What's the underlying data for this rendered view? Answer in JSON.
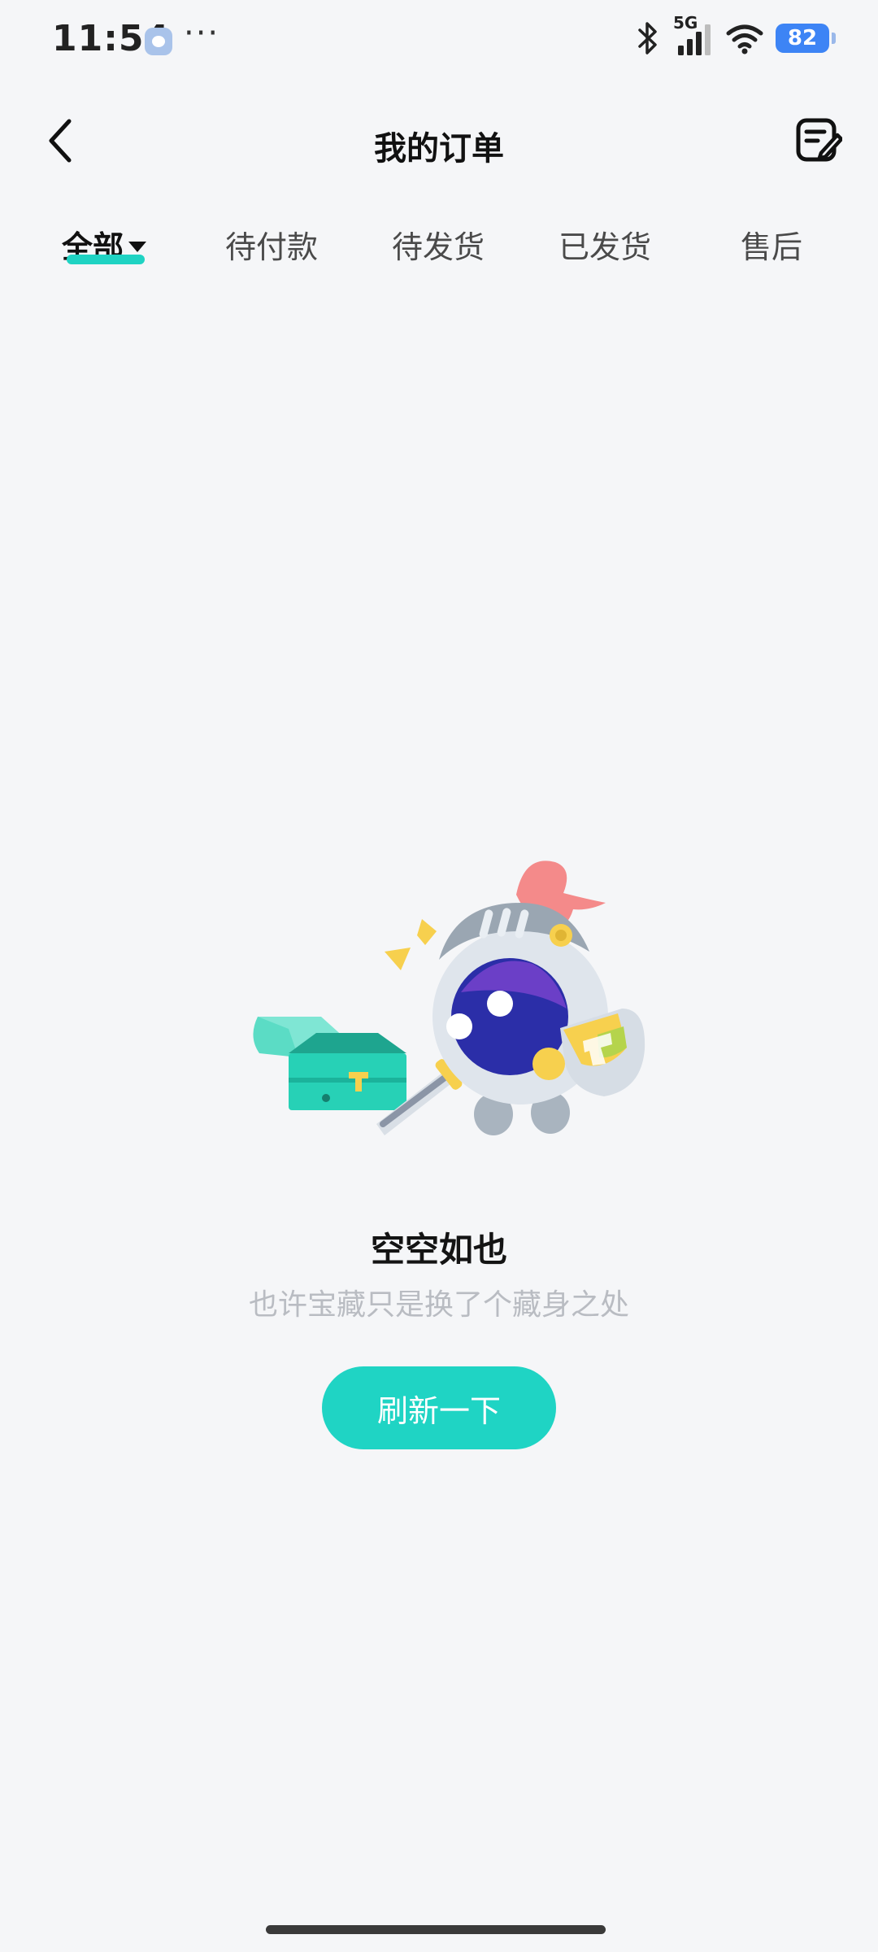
{
  "status_bar": {
    "time": "11:54",
    "more": "···",
    "network": "5G",
    "battery": "82",
    "icons": [
      "app-notification-icon",
      "bluetooth-icon",
      "signal-icon",
      "wifi-icon",
      "battery-icon"
    ]
  },
  "header": {
    "title": "我的订单",
    "back_icon": "chevron-left-icon",
    "edit_icon": "note-edit-icon"
  },
  "tabs": [
    {
      "label": "全部",
      "active": true
    },
    {
      "label": "待付款",
      "active": false
    },
    {
      "label": "待发货",
      "active": false
    },
    {
      "label": "已发货",
      "active": false
    },
    {
      "label": "售后",
      "active": false
    }
  ],
  "empty_state": {
    "illustration": "knight-treasure-chest-illustration",
    "title": "空空如也",
    "subtitle": "也许宝藏只是换了个藏身之处",
    "button_label": "刷新一下"
  },
  "colors": {
    "accent": "#1fd4c4",
    "background": "#f5f6f8",
    "subtitle": "#b9bcc2",
    "battery": "#3d84f5"
  }
}
